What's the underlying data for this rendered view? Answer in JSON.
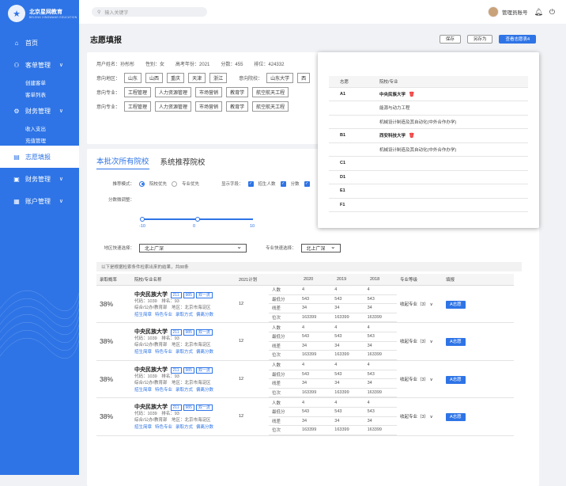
{
  "sidebar": {
    "logo_title": "北京星网教育",
    "logo_sub": "BEIJING XINGWANG EDUCATION",
    "items": [
      {
        "label": "首页"
      },
      {
        "label": "客单管理"
      },
      {
        "label": "财务管理"
      },
      {
        "label": "志愿填报"
      },
      {
        "label": "财务管理"
      },
      {
        "label": "账户管理"
      }
    ],
    "sub_customer": [
      "创建客单",
      "客单列表"
    ],
    "sub_finance": [
      "收入支出",
      "充值管理"
    ]
  },
  "topbar": {
    "search_placeholder": "输入关键字",
    "user": "管理员账号"
  },
  "header": {
    "title": "志愿填报",
    "save": "保存",
    "save_as": "另存为",
    "view": "查看志愿表4"
  },
  "info": {
    "name": "用户姓名：孙彤彤",
    "gender": "性别：女",
    "year": "高考年份：2021",
    "score": "分数：455",
    "rank": "排位：424332"
  },
  "region": {
    "label": "意向地区：",
    "tags": [
      "山东",
      "山西",
      "重庆",
      "天津",
      "浙江"
    ]
  },
  "college": {
    "label": "意向院校：",
    "tags": [
      "山东大学",
      "西"
    ]
  },
  "major": {
    "label": "意向专业：",
    "rows": [
      [
        "工程管理",
        "人力资源管理",
        "市场营销",
        "教育学",
        "航空航天工程"
      ],
      [
        "工程管理",
        "人力资源管理",
        "市场营销",
        "教育学",
        "航空航天工程"
      ]
    ]
  },
  "tabs": [
    "本批次所有院校",
    "系统推荐院校"
  ],
  "opts": {
    "mode": "推荐模式：",
    "mode_a": "院校优先",
    "mode_b": "专业优先",
    "show": "显示字段：",
    "f1": "招生人数",
    "f2": "分数",
    "adj": "分数微调整：",
    "t1": "-10",
    "t2": "0",
    "t3": "10",
    "region_sel": "地区快速选择：",
    "region_val": "北上广深",
    "major_sel": "专业快速选择：",
    "major_val": "北上广深"
  },
  "results": "以下是根据检索条件检索出来的结果，共88条",
  "cols": [
    "录取概率",
    "院校/专业名称",
    "2021计划",
    "",
    "2020",
    "2019",
    "2018",
    "专业等级",
    "填报"
  ],
  "rows": [
    {
      "prob": "38%",
      "name": "中央民族大学",
      "b1": "211",
      "b2": "985",
      "b3": "双一流",
      "code": "代码：1039　排名：93",
      "meta": "综合/公办/教育部　地区：北京市海淀区",
      "links": [
        "招生简章",
        "特色专业",
        "录取方式",
        "偏离分数"
      ],
      "plan": "12",
      "stats": [
        [
          "人数",
          "4",
          "4",
          "4"
        ],
        [
          "最低分",
          "543",
          "543",
          "543"
        ],
        [
          "线差",
          "34",
          "34",
          "34"
        ],
        [
          "位次",
          "163399",
          "163399",
          "163399"
        ]
      ],
      "level": "收起专业（3）",
      "act": "A志愿"
    },
    {
      "prob": "38%",
      "name": "中央民族大学",
      "b1": "211",
      "b2": "985",
      "b3": "双一流",
      "code": "代码：1039　排名：93",
      "meta": "综合/公办/教育部　地区：北京市海淀区",
      "links": [
        "招生简章",
        "特色专业",
        "录取方式",
        "偏离分数"
      ],
      "plan": "12",
      "stats": [
        [
          "人数",
          "4",
          "4",
          "4"
        ],
        [
          "最低分",
          "543",
          "543",
          "543"
        ],
        [
          "线差",
          "34",
          "34",
          "34"
        ],
        [
          "位次",
          "163399",
          "163399",
          "163399"
        ]
      ],
      "level": "收起专业（3）",
      "act": "A志愿"
    },
    {
      "prob": "38%",
      "name": "中央民族大学",
      "b1": "211",
      "b2": "985",
      "b3": "双一流",
      "code": "代码：1039　排名：93",
      "meta": "综合/公办/教育部　地区：北京市海淀区",
      "links": [
        "招生简章",
        "特色专业",
        "录取方式",
        "偏离分数"
      ],
      "plan": "12",
      "stats": [
        [
          "人数",
          "4",
          "4",
          "4"
        ],
        [
          "最低分",
          "543",
          "543",
          "543"
        ],
        [
          "线差",
          "34",
          "34",
          "34"
        ],
        [
          "位次",
          "163399",
          "163399",
          "163399"
        ]
      ],
      "level": "收起专业（3）",
      "act": "A志愿"
    },
    {
      "prob": "38%",
      "name": "中央民族大学",
      "b1": "211",
      "b2": "985",
      "b3": "双一流",
      "code": "代码：1039　排名：93",
      "meta": "综合/公办/教育部　地区：北京市海淀区",
      "links": [
        "招生简章",
        "特色专业",
        "录取方式",
        "偏离分数"
      ],
      "plan": "12",
      "stats": [
        [
          "人数",
          "4",
          "4",
          "4"
        ],
        [
          "最低分",
          "543",
          "543",
          "543"
        ],
        [
          "线差",
          "34",
          "34",
          "34"
        ],
        [
          "位次",
          "163399",
          "163399",
          "163399"
        ]
      ],
      "level": "收起专业（3）",
      "act": "A志愿"
    }
  ],
  "popup": {
    "h1": "志愿",
    "h2": "院校/专业",
    "rows": [
      [
        "A1",
        "中央民族大学",
        true
      ],
      [
        "",
        "能源与动力工程",
        false
      ],
      [
        "",
        "机械设计制造及其自动化(中外合作办学)",
        false
      ],
      [
        "B1",
        "西安科技大学",
        true
      ],
      [
        "",
        "机械设计制造及其自动化(中外合作办学)",
        false
      ],
      [
        "C1",
        "",
        false
      ],
      [
        "D1",
        "",
        false
      ],
      [
        "E1",
        "",
        false
      ],
      [
        "F1",
        "",
        false
      ]
    ]
  },
  "colors": {
    "primary": "#2e74e6"
  }
}
